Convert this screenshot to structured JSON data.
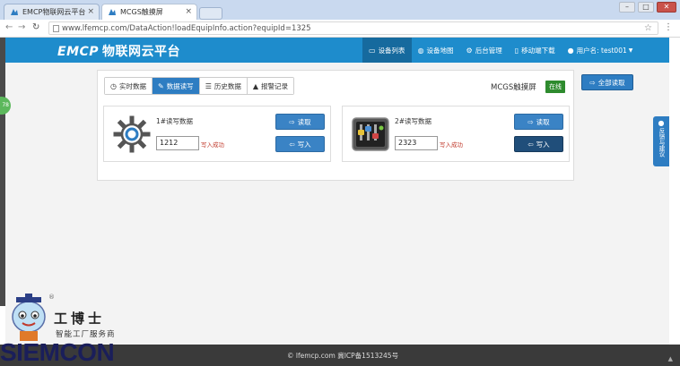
{
  "browser": {
    "tabs": [
      {
        "label": "EMCP物联网云平台",
        "active": false
      },
      {
        "label": "MCGS触摸屏",
        "active": true
      }
    ],
    "url": "www.lfemcp.com/DataAction!loadEquipInfo.action?equipId=1325"
  },
  "header": {
    "logo_brand": "EMCP",
    "logo_text": "物联网云平台",
    "nav": [
      {
        "label": "设备列表",
        "icon": "monitor-icon",
        "active": true
      },
      {
        "label": "设备地图",
        "icon": "globe-icon",
        "active": false
      },
      {
        "label": "后台管理",
        "icon": "cogs-icon",
        "active": false
      },
      {
        "label": "移动端下载",
        "icon": "phone-icon",
        "active": false
      },
      {
        "label": "用户名: test001",
        "icon": "user-icon",
        "active": false
      }
    ]
  },
  "panel": {
    "tabs": [
      {
        "label": "实时数据",
        "icon": "clock-icon",
        "active": false
      },
      {
        "label": "数据读写",
        "icon": "pencil-icon",
        "active": true
      },
      {
        "label": "历史数据",
        "icon": "list-icon",
        "active": false
      },
      {
        "label": "报警记录",
        "icon": "bell-icon",
        "active": false
      }
    ],
    "device_name": "MCGS触摸屏",
    "status": "在线",
    "read_all_label": "全部读取"
  },
  "cards": [
    {
      "title": "1#读写数据",
      "value": "1212",
      "write_status": "写入成功",
      "read_label": "读取",
      "write_label": "写入",
      "icon": "gear-icon"
    },
    {
      "title": "2#读写数据",
      "value": "2323",
      "write_status": "写入成功",
      "read_label": "读取",
      "write_label": "写入",
      "icon": "control-panel-icon"
    }
  ],
  "side": {
    "left_badge": "78",
    "feedback": "反馈与建议"
  },
  "footer": {
    "text": "lfemcp.com 冀ICP备1513245号"
  },
  "watermark": {
    "cn": "工博士",
    "sub": "智能工厂服务商",
    "brand": "SIEMCON"
  },
  "colors": {
    "header": "#1e8ccc",
    "primary_button": "#2e7dc2",
    "online": "#2e8b2e",
    "status_text": "#c0392b"
  }
}
